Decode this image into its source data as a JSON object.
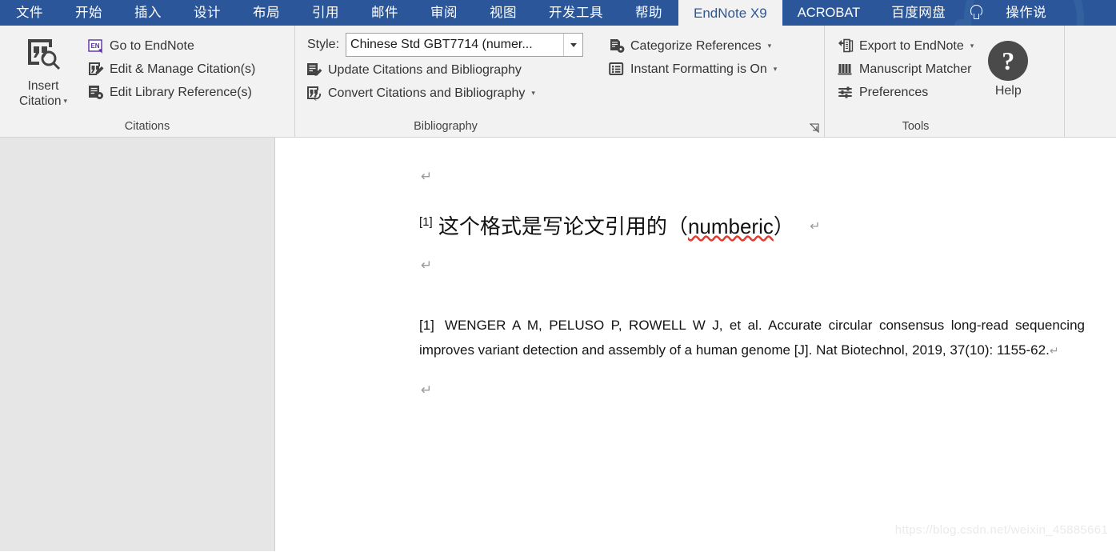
{
  "window": {
    "ribbon_tabs": [
      {
        "label": "文件",
        "active": false
      },
      {
        "label": "开始",
        "active": false
      },
      {
        "label": "插入",
        "active": false
      },
      {
        "label": "设计",
        "active": false
      },
      {
        "label": "布局",
        "active": false
      },
      {
        "label": "引用",
        "active": false
      },
      {
        "label": "邮件",
        "active": false
      },
      {
        "label": "审阅",
        "active": false
      },
      {
        "label": "视图",
        "active": false
      },
      {
        "label": "开发工具",
        "active": false
      },
      {
        "label": "帮助",
        "active": false
      },
      {
        "label": "EndNote X9",
        "active": true
      },
      {
        "label": "ACROBAT",
        "active": false
      },
      {
        "label": "百度网盘",
        "active": false
      },
      {
        "label": "操作说",
        "active": false
      }
    ],
    "tell_me_icon": "lightbulb-icon"
  },
  "ribbon": {
    "groups": [
      {
        "name": "citations",
        "label": "Citations",
        "big_button": {
          "line1": "Insert",
          "line2": "Citation",
          "caret": "▾",
          "icon": "insert-citation-icon"
        },
        "commands": [
          {
            "label": "Go to EndNote",
            "icon": "endnote-icon",
            "caret": ""
          },
          {
            "label": "Edit & Manage Citation(s)",
            "icon": "edit-citation-icon",
            "caret": ""
          },
          {
            "label": "Edit Library Reference(s)",
            "icon": "edit-library-reference-icon",
            "caret": ""
          }
        ]
      },
      {
        "name": "bibliography",
        "label": "Bibliography",
        "style": {
          "label": "Style:",
          "value": "Chinese Std GBT7714 (numer...",
          "placeholder": "Select a style",
          "dropdown_icon": "chevron-down-icon"
        },
        "commands": [
          {
            "label": "Update Citations and Bibliography",
            "icon": "update-bibliography-icon",
            "caret": ""
          },
          {
            "label": "Convert Citations and Bibliography",
            "icon": "convert-bibliography-icon",
            "caret": "▾"
          }
        ],
        "dialog_launcher": "dialog-launcher-icon"
      },
      {
        "name": "references-options",
        "label": "",
        "commands": [
          {
            "label": "Categorize References",
            "icon": "categorize-references-icon",
            "caret": "▾"
          },
          {
            "label": "Instant Formatting is On",
            "icon": "instant-formatting-icon",
            "caret": "▾"
          }
        ]
      },
      {
        "name": "tools",
        "label": "Tools",
        "commands": [
          {
            "label": "Export to EndNote",
            "icon": "export-to-endnote-icon",
            "caret": "▾"
          },
          {
            "label": "Manuscript Matcher",
            "icon": "manuscript-matcher-icon",
            "caret": ""
          },
          {
            "label": "Preferences",
            "icon": "preferences-icon",
            "caret": ""
          }
        ],
        "help": {
          "label": "Help",
          "glyph": "?",
          "icon": "help-icon"
        }
      }
    ]
  },
  "document": {
    "paragraph_mark": "↵",
    "heading": {
      "citation_number": "[1]",
      "text_before": "这个格式是写论文引用的（",
      "misspelled_word": "numberic",
      "text_after": "）"
    },
    "reference": {
      "number": "[1]",
      "text": "WENGER A M, PELUSO P, ROWELL W J, et al. Accurate circular consensus long-read sequencing improves variant detection and assembly of a human genome [J]. Nat Biotechnol, 2019, 37(10): 1155-62."
    },
    "watermark": "https://blog.csdn.net/weixin_45885661"
  },
  "colors": {
    "ribbon_blue": "#2b579a",
    "ribbon_background": "#f2f2f2",
    "active_tab_text": "#2b579a",
    "spellcheck_red": "#e33c2e",
    "left_pane_gray": "#e6e6e6"
  }
}
